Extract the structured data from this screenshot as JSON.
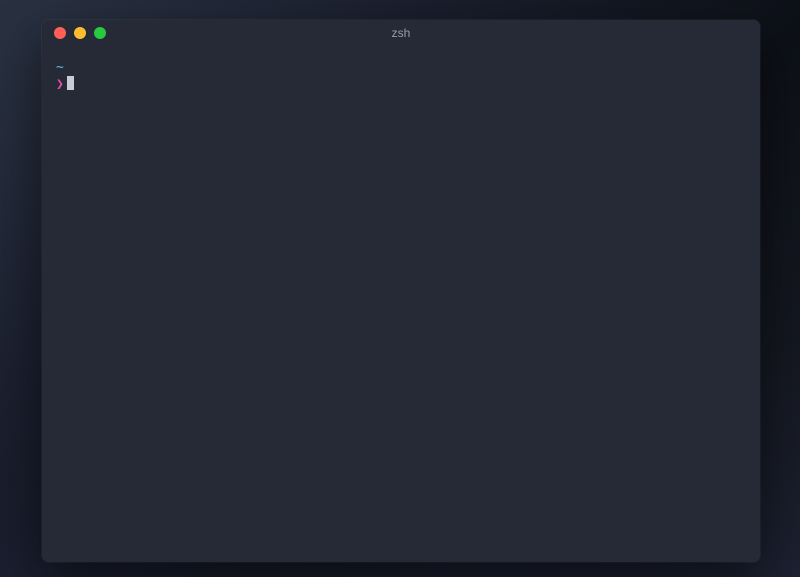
{
  "window": {
    "title": "zsh"
  },
  "terminal": {
    "cwd": "~",
    "prompt_symbol": "❯",
    "input_value": ""
  },
  "colors": {
    "background": "#262a37",
    "cwd": "#56c2d6",
    "prompt": "#e651a6",
    "cursor": "#c8ccd4"
  }
}
